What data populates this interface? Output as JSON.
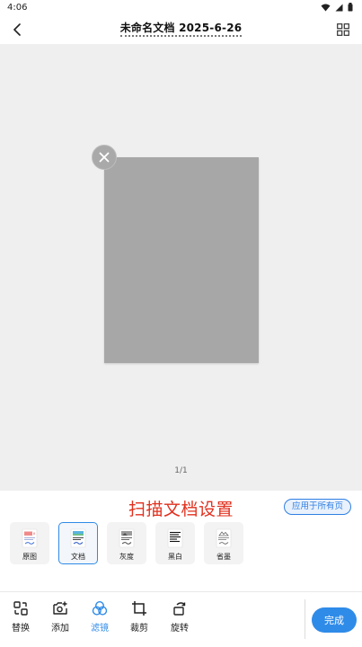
{
  "status_bar": {
    "time": "4:06"
  },
  "header": {
    "title": "未命名文档 2025-6-26"
  },
  "canvas": {
    "page_counter": "1/1"
  },
  "panel": {
    "title": "扫描文档设置",
    "apply_all_label": "应用于所有页",
    "filters": [
      {
        "label": "原图",
        "icon": "original-thumbnail"
      },
      {
        "label": "文档",
        "icon": "document-thumbnail",
        "selected": true
      },
      {
        "label": "灰度",
        "icon": "grayscale-thumbnail"
      },
      {
        "label": "黑白",
        "icon": "black-white-thumbnail"
      },
      {
        "label": "省墨",
        "icon": "ink-saving-thumbnail"
      }
    ]
  },
  "toolbar": {
    "tools": [
      {
        "label": "替换",
        "icon": "replace-icon"
      },
      {
        "label": "添加",
        "icon": "add-photo-icon"
      },
      {
        "label": "滤镜",
        "icon": "filter-icon",
        "active": true
      },
      {
        "label": "裁剪",
        "icon": "crop-icon"
      },
      {
        "label": "旋转",
        "icon": "rotate-icon"
      }
    ],
    "done_label": "完成"
  },
  "colors": {
    "accent": "#2f8be8",
    "panel_title": "#e0301e",
    "canvas_bg": "#efefef",
    "page": "#a7a7a7"
  }
}
